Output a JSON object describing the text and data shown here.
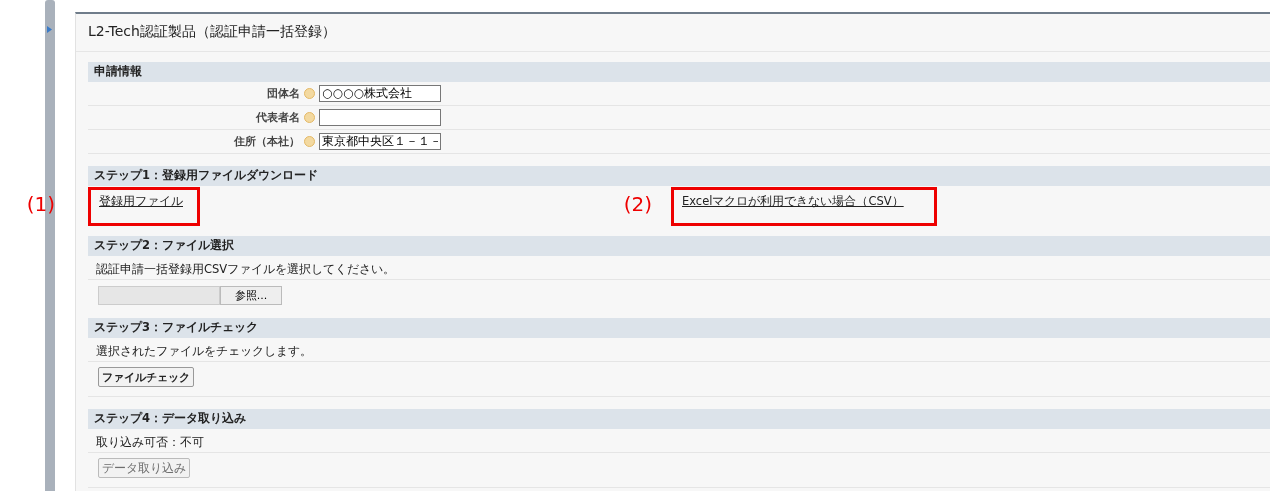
{
  "title": "L2-Tech認証製品（認証申請一括登録）",
  "application_info": {
    "heading": "申請情報",
    "fields": [
      {
        "label": "団体名",
        "value": "○○○○株式会社"
      },
      {
        "label": "代表者名"
      },
      {
        "label": "住所（本社）",
        "value": "東京都中央区１－１－"
      }
    ]
  },
  "steps": [
    {
      "kind": "links",
      "heading": "ステップ1：登録用ファイルダウンロード",
      "links": [
        {
          "text": "登録用ファイル",
          "annotation": "(1)"
        },
        {
          "text": "Excelマクロが利用できない場合（CSV）",
          "annotation": "(2)"
        }
      ]
    },
    {
      "kind": "file",
      "heading": "ステップ2：ファイル選択",
      "description": "認証申請一括登録用CSVファイルを選択してください。",
      "browse_button": "参照..."
    },
    {
      "kind": "action",
      "heading": "ステップ3：ファイルチェック",
      "description": "選択されたファイルをチェックします。",
      "button": {
        "label": "ファイルチェック",
        "disabled": false
      }
    },
    {
      "kind": "action",
      "heading": "ステップ4：データ取り込み",
      "description": "取り込み可否：不可",
      "button": {
        "label": "データ取り込み",
        "disabled": true
      }
    }
  ]
}
